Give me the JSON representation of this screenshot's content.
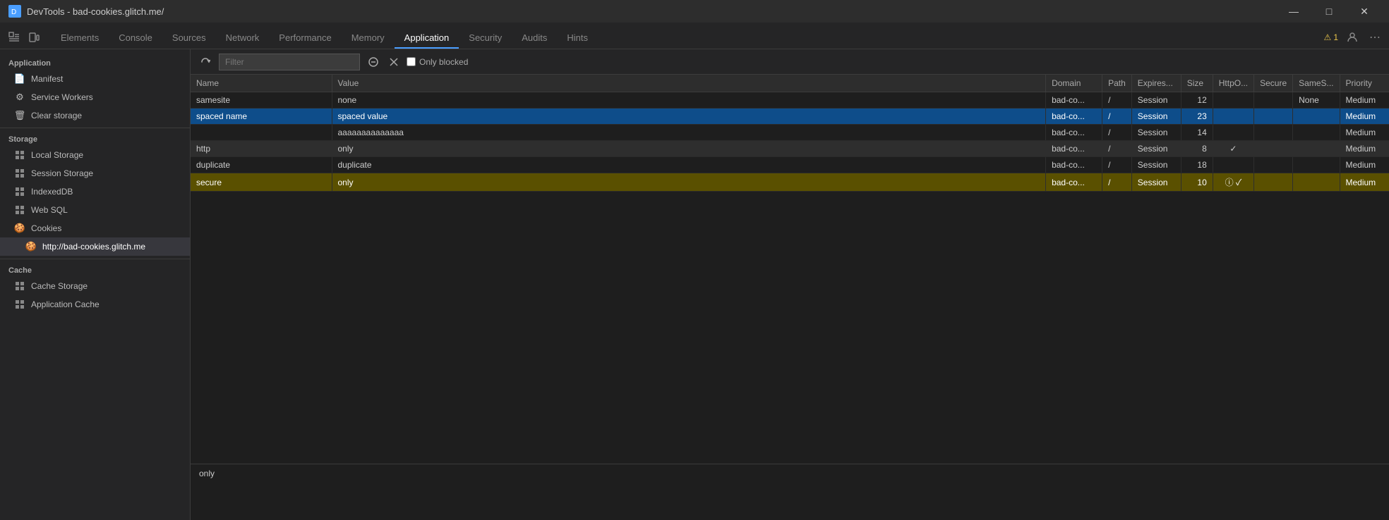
{
  "titleBar": {
    "icon": "🔧",
    "title": "DevTools - bad-cookies.glitch.me/",
    "minimizeLabel": "—",
    "maximizeLabel": "□",
    "closeLabel": "✕"
  },
  "tabs": {
    "items": [
      {
        "label": "Elements",
        "active": false
      },
      {
        "label": "Console",
        "active": false
      },
      {
        "label": "Sources",
        "active": false
      },
      {
        "label": "Network",
        "active": false
      },
      {
        "label": "Performance",
        "active": false
      },
      {
        "label": "Memory",
        "active": false
      },
      {
        "label": "Application",
        "active": true
      },
      {
        "label": "Security",
        "active": false
      },
      {
        "label": "Audits",
        "active": false
      },
      {
        "label": "Hints",
        "active": false
      }
    ],
    "warningCount": "1",
    "moreLabel": "⋯"
  },
  "sidebar": {
    "appHeader": "Application",
    "items": [
      {
        "id": "manifest",
        "label": "Manifest",
        "icon": "📄"
      },
      {
        "id": "service-workers",
        "label": "Service Workers",
        "icon": "⚙"
      },
      {
        "id": "clear-storage",
        "label": "Clear storage",
        "icon": "🗑"
      }
    ],
    "storageHeader": "Storage",
    "storageItems": [
      {
        "id": "local-storage",
        "label": "Local Storage",
        "icon": "▦"
      },
      {
        "id": "session-storage",
        "label": "Session Storage",
        "icon": "▦"
      },
      {
        "id": "indexeddb",
        "label": "IndexedDB",
        "icon": "▦"
      },
      {
        "id": "web-sql",
        "label": "Web SQL",
        "icon": "▦"
      },
      {
        "id": "cookies",
        "label": "Cookies",
        "icon": "🍪",
        "active": true
      }
    ],
    "cookieSubItems": [
      {
        "id": "cookie-url",
        "label": "http://bad-cookies.glitch.me",
        "icon": "🍪",
        "active": true
      }
    ],
    "cacheHeader": "Cache",
    "cacheItems": [
      {
        "id": "cache-storage",
        "label": "Cache Storage",
        "icon": "▦"
      },
      {
        "id": "app-cache",
        "label": "Application Cache",
        "icon": "▦"
      }
    ]
  },
  "toolbar": {
    "refreshLabel": "↻",
    "filterPlaceholder": "Filter",
    "clearLabel": "🚫",
    "deleteLabel": "✕",
    "onlyBlockedLabel": "Only blocked"
  },
  "table": {
    "columns": [
      {
        "key": "name",
        "label": "Name"
      },
      {
        "key": "value",
        "label": "Value"
      },
      {
        "key": "domain",
        "label": "Domain"
      },
      {
        "key": "path",
        "label": "Path"
      },
      {
        "key": "expires",
        "label": "Expires..."
      },
      {
        "key": "size",
        "label": "Size"
      },
      {
        "key": "httpOnly",
        "label": "HttpO..."
      },
      {
        "key": "secure",
        "label": "Secure"
      },
      {
        "key": "samesite",
        "label": "SameS..."
      },
      {
        "key": "priority",
        "label": "Priority"
      }
    ],
    "rows": [
      {
        "name": "samesite",
        "value": "none",
        "domain": "bad-co...",
        "path": "/",
        "expires": "Session",
        "size": "12",
        "httpOnly": "",
        "secure": "",
        "samesite": "None",
        "priority": "Medium",
        "rowClass": ""
      },
      {
        "name": "spaced name",
        "value": "spaced value",
        "domain": "bad-co...",
        "path": "/",
        "expires": "Session",
        "size": "23",
        "httpOnly": "",
        "secure": "",
        "samesite": "",
        "priority": "Medium",
        "rowClass": "selected"
      },
      {
        "name": "",
        "value": "aaaaaaaaaaaaaa",
        "domain": "bad-co...",
        "path": "/",
        "expires": "Session",
        "size": "14",
        "httpOnly": "",
        "secure": "",
        "samesite": "",
        "priority": "Medium",
        "rowClass": ""
      },
      {
        "name": "http",
        "value": "only",
        "domain": "bad-co...",
        "path": "/",
        "expires": "Session",
        "size": "8",
        "httpOnly": "✓",
        "secure": "",
        "samesite": "",
        "priority": "Medium",
        "rowClass": "http-row"
      },
      {
        "name": "duplicate",
        "value": "duplicate",
        "domain": "bad-co...",
        "path": "/",
        "expires": "Session",
        "size": "18",
        "httpOnly": "",
        "secure": "",
        "samesite": "",
        "priority": "Medium",
        "rowClass": ""
      },
      {
        "name": "secure",
        "value": "only",
        "domain": "bad-co...",
        "path": "/",
        "expires": "Session",
        "size": "10",
        "httpOnly": "ⓘ ✓",
        "secure": "",
        "samesite": "",
        "priority": "Medium",
        "rowClass": "highlighted"
      }
    ]
  },
  "preview": {
    "value": "only"
  }
}
